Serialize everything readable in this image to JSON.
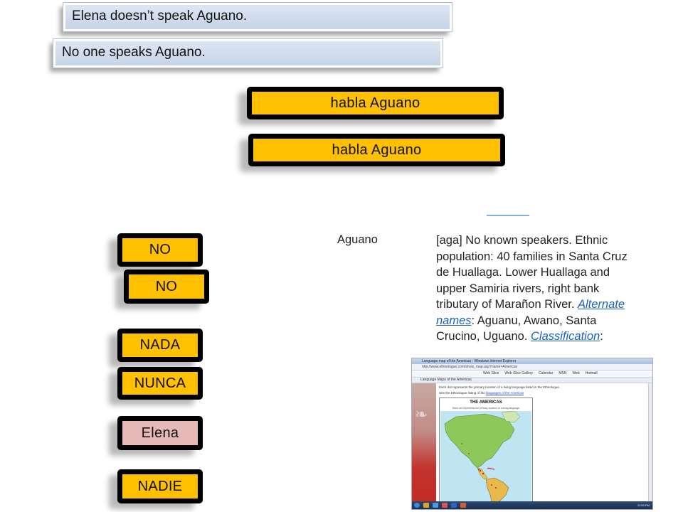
{
  "sentences": {
    "english_1": "Elena doesn’t speak Aguano.",
    "english_2": "No one speaks Aguano."
  },
  "phrase_tiles": [
    "habla Aguano",
    "habla Aguano"
  ],
  "word_tiles": {
    "no_1": "NO",
    "no_2": "NO",
    "nada": "NADA",
    "nunca": "NUNCA",
    "elena": "Elena",
    "nadie": "NADIE"
  },
  "colors": {
    "tile_yellow": "#ffc000",
    "tile_pink": "#e6b9b8",
    "tile_border": "#000000",
    "strip_blue": "#c6d3e7",
    "link_blue": "#1a62b8"
  },
  "ethnologue_excerpt": {
    "term": "Aguano",
    "description_1": "[aga] No known speakers. Ethnic population: 40 families in Santa Cruz de Huallaga. Lower Huallaga and upper Samiria rivers, right bank tributary of Marañon River. ",
    "link_1": "Alternate names",
    "description_2": ": Aguanu, Awano, Santa Crucino, Uguano. ",
    "link_2": "Classification",
    "description_3": ":"
  },
  "browser_screenshot": {
    "window_title": "Language map of the Americas - Windows Internet Explorer",
    "address": "http://www.ethnologue.com/show_map.asp?name=Americas",
    "menu": [
      "Web Slice",
      "Web Slice Gallery",
      "Calendar",
      "MSN",
      "Web",
      "Hotmail"
    ],
    "tab_label": "Language Maps of the Americas",
    "note_1": "Each dot represents the primary location of a living language listed in the Ethnologue.",
    "note_2_prefix": "See the Ethnologue listing of the ",
    "note_2_link": "languages of the Americas",
    "map_title": "THE AMERICAS",
    "map_subtitle": "Each dot represents the primary location of a living language",
    "clock": "12:00 PM"
  }
}
